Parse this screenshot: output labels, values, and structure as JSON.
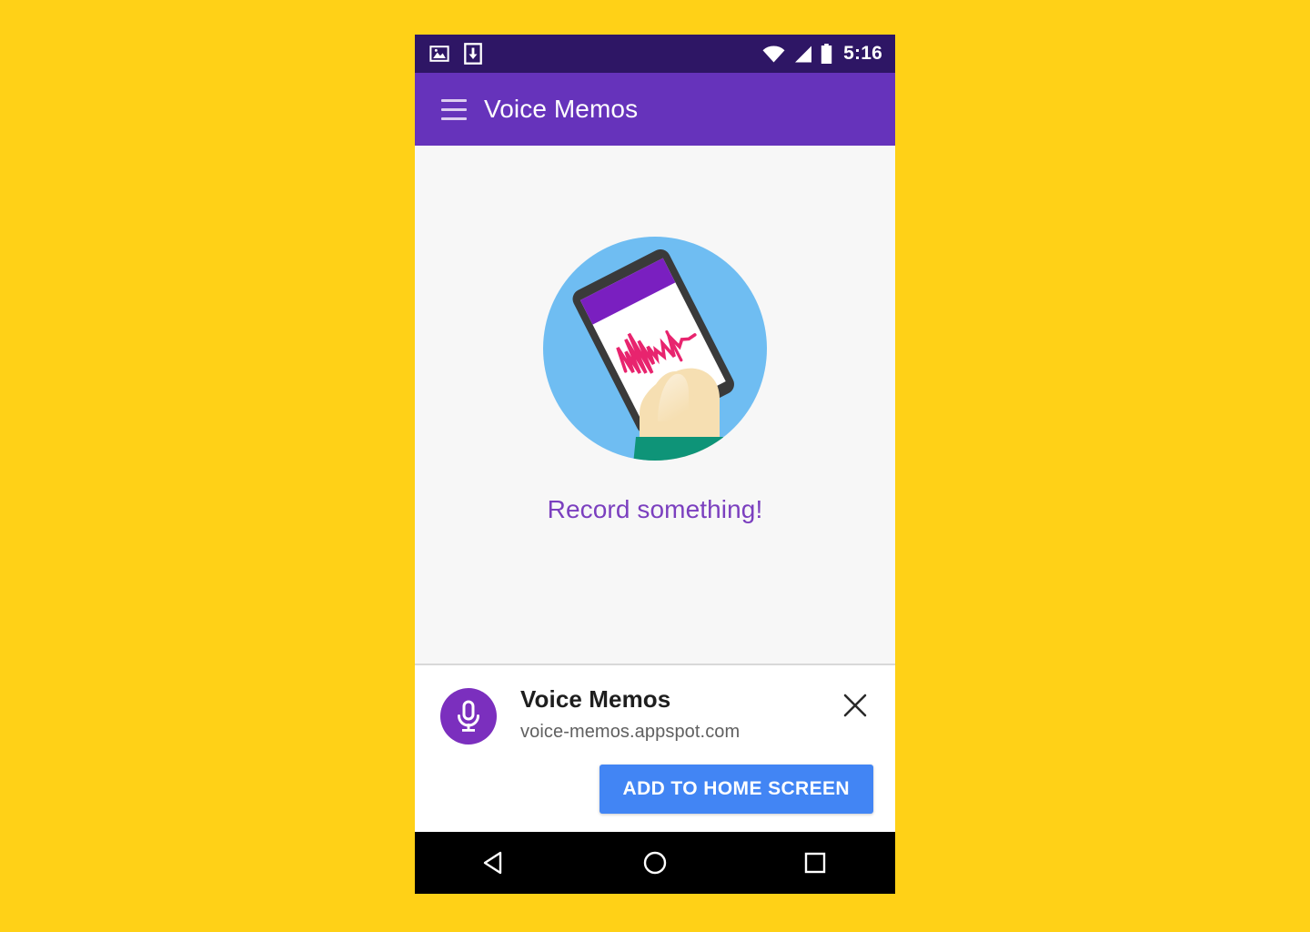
{
  "status_bar": {
    "left_icons": [
      {
        "name": "image-icon",
        "label": "screenshot"
      },
      {
        "name": "download-icon",
        "label": "download"
      }
    ],
    "right_icons": [
      {
        "name": "wifi-icon",
        "label": "wifi"
      },
      {
        "name": "cellular-signal-icon",
        "label": "signal"
      },
      {
        "name": "battery-icon",
        "label": "battery"
      }
    ],
    "time": "5:16",
    "background_color": "#2E1665"
  },
  "app_bar": {
    "menu_icon": "hamburger-menu-icon",
    "title": "Voice Memos",
    "background_color": "#6633BB",
    "text_color": "#FFFFFF"
  },
  "content": {
    "illustration": "hand-holding-phone-with-waveform-illustration",
    "empty_message": "Record something!",
    "empty_message_color": "#7B3FBF",
    "background_color": "#F7F7F7",
    "illustration_colors": {
      "circle": "#6FBDF2",
      "phone_body": "#3A3A3A",
      "phone_screen": "#FFFFFF",
      "phone_header": "#7A1FC0",
      "waveform": "#E8246E",
      "skin": "#F6DFB2",
      "sleeve": "#0E9478"
    }
  },
  "install_banner": {
    "app_icon": "microphone-icon",
    "app_icon_background": "#7B2FBE",
    "app_name": "Voice Memos",
    "origin": "voice-memos.appspot.com",
    "close_icon": "close-icon",
    "install_label": "ADD TO HOME SCREEN",
    "install_button_color": "#4285F4"
  },
  "nav_bar": {
    "background_color": "#000000",
    "keys": [
      {
        "name": "back-button",
        "icon": "triangle-left-icon"
      },
      {
        "name": "home-button",
        "icon": "circle-icon"
      },
      {
        "name": "recents-button",
        "icon": "square-icon"
      }
    ]
  },
  "page": {
    "background_color": "#FFD117"
  }
}
